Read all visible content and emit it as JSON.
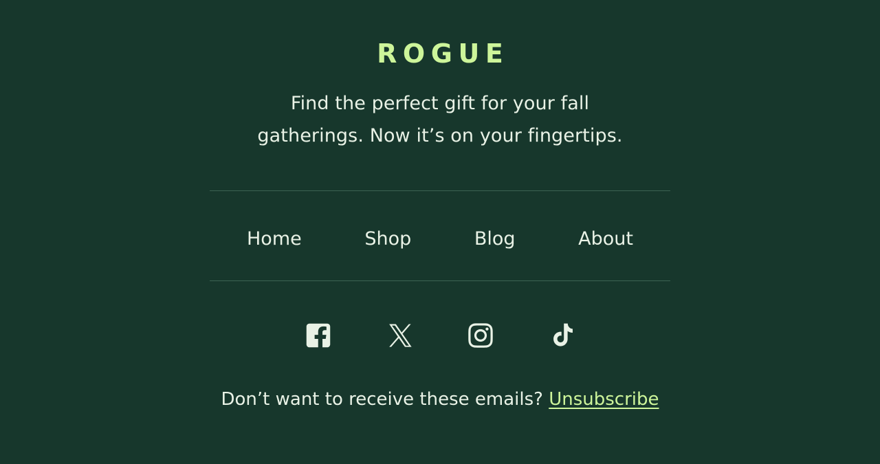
{
  "theme": {
    "background": "#17372c",
    "accent": "#cdf59a",
    "text": "#e9f2e6",
    "rule": "#3c6353"
  },
  "brand": {
    "wordmark": "ROGUE"
  },
  "tagline": {
    "text": "Find the perfect gift for your fall gatherings. Now it’s on your fingertips."
  },
  "nav": {
    "items": [
      {
        "label": "Home",
        "icon": "home-link"
      },
      {
        "label": "Shop",
        "icon": "shop-link"
      },
      {
        "label": "Blog",
        "icon": "blog-link"
      },
      {
        "label": "About",
        "icon": "about-link"
      }
    ]
  },
  "social": {
    "items": [
      {
        "name": "Facebook",
        "icon": "facebook-icon"
      },
      {
        "name": "X",
        "icon": "x-twitter-icon"
      },
      {
        "name": "Instagram",
        "icon": "instagram-icon"
      },
      {
        "name": "TikTok",
        "icon": "tiktok-icon"
      }
    ]
  },
  "unsubscribe": {
    "prompt": "Don’t want to receive these emails?",
    "link_label": "Unsubscribe"
  }
}
